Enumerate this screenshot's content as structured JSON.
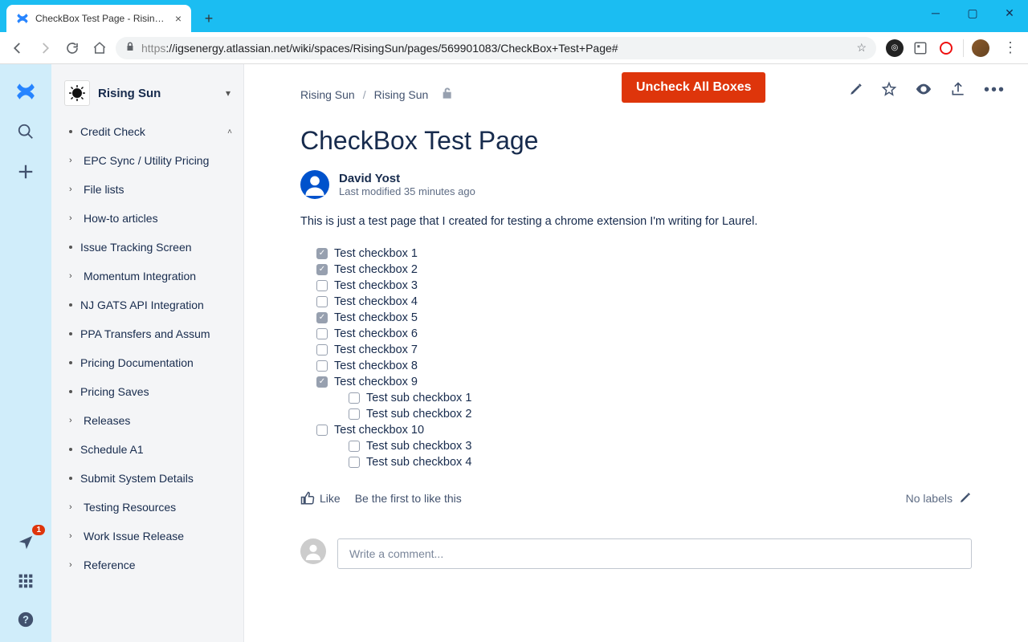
{
  "browser": {
    "tab_title": "CheckBox Test Page - Rising Sun",
    "url_scheme": "https",
    "url_rest": "://igsenergy.atlassian.net/wiki/spaces/RisingSun/pages/569901083/CheckBox+Test+Page#",
    "notification_count": "1"
  },
  "sidebar": {
    "space_name": "Rising Sun",
    "items": [
      {
        "label": "Credit Check",
        "expandable": false,
        "expanded_caret": true
      },
      {
        "label": "EPC Sync / Utility Pricing",
        "expandable": true
      },
      {
        "label": "File lists",
        "expandable": true
      },
      {
        "label": "How-to articles",
        "expandable": true
      },
      {
        "label": "Issue Tracking Screen",
        "expandable": false
      },
      {
        "label": "Momentum Integration",
        "expandable": true
      },
      {
        "label": "NJ GATS API Integration",
        "expandable": false
      },
      {
        "label": "PPA Transfers and Assum",
        "expandable": false
      },
      {
        "label": "Pricing Documentation",
        "expandable": false
      },
      {
        "label": "Pricing Saves",
        "expandable": false
      },
      {
        "label": "Releases",
        "expandable": true
      },
      {
        "label": "Schedule A1",
        "expandable": false
      },
      {
        "label": "Submit System Details",
        "expandable": false
      },
      {
        "label": "Testing Resources",
        "expandable": true
      },
      {
        "label": "Work Issue Release",
        "expandable": true
      },
      {
        "label": "Reference",
        "expandable": true
      }
    ]
  },
  "page": {
    "uncheck_label": "Uncheck All Boxes",
    "breadcrumb": [
      "Rising Sun",
      "Rising Sun"
    ],
    "title": "CheckBox Test Page",
    "author": "David Yost",
    "modified": "Last modified 35 minutes ago",
    "intro": "This is just a test page that I created for testing a chrome extension I'm writing for Laurel.",
    "checkboxes": [
      {
        "label": "Test checkbox 1",
        "checked": true,
        "sub": false
      },
      {
        "label": "Test checkbox 2",
        "checked": true,
        "sub": false
      },
      {
        "label": "Test checkbox 3",
        "checked": false,
        "sub": false
      },
      {
        "label": "Test checkbox 4",
        "checked": false,
        "sub": false
      },
      {
        "label": "Test checkbox 5",
        "checked": true,
        "sub": false
      },
      {
        "label": "Test checkbox 6",
        "checked": false,
        "sub": false
      },
      {
        "label": "Test checkbox 7",
        "checked": false,
        "sub": false
      },
      {
        "label": "Test checkbox 8",
        "checked": false,
        "sub": false
      },
      {
        "label": "Test checkbox 9",
        "checked": true,
        "sub": false
      },
      {
        "label": "Test sub checkbox 1",
        "checked": false,
        "sub": true
      },
      {
        "label": "Test sub checkbox 2",
        "checked": false,
        "sub": true
      },
      {
        "label": "Test checkbox 10",
        "checked": false,
        "sub": false
      },
      {
        "label": "Test sub checkbox 3",
        "checked": false,
        "sub": true
      },
      {
        "label": "Test sub checkbox 4",
        "checked": false,
        "sub": true
      }
    ],
    "like_label": "Like",
    "be_first": "Be the first to like this",
    "no_labels": "No labels",
    "comment_placeholder": "Write a comment..."
  }
}
